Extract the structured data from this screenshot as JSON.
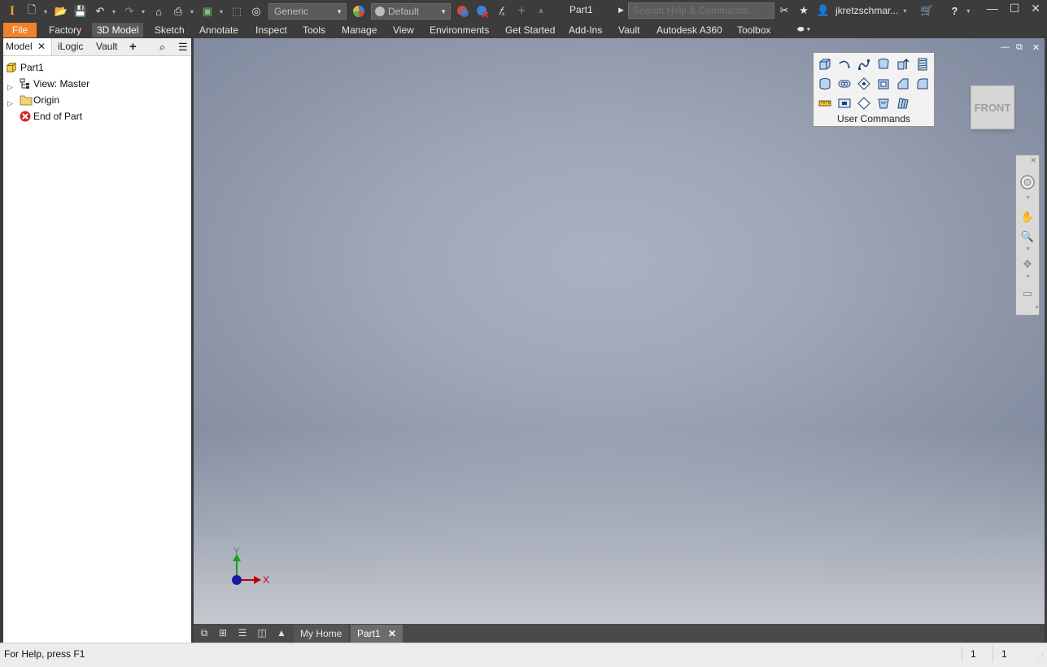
{
  "app": {
    "doc_title": "Part1"
  },
  "toolbar": {
    "material": "Generic",
    "appearance": "Default",
    "search_placeholder": "Search Help & Commands...",
    "user": "jkretzschmar..."
  },
  "ribbon": {
    "tabs": [
      "File",
      "Factory",
      "3D Model",
      "Sketch",
      "Annotate",
      "Inspect",
      "Tools",
      "Manage",
      "View",
      "Environments",
      "Get Started",
      "Add-Ins",
      "Vault",
      "Autodesk A360",
      "Toolbox"
    ],
    "active_tab": "3D Model"
  },
  "browser": {
    "tabs": [
      "Model",
      "iLogic",
      "Vault"
    ],
    "tree": [
      {
        "label": "Part1"
      },
      {
        "label": "View: Master"
      },
      {
        "label": "Origin"
      },
      {
        "label": "End of Part"
      }
    ]
  },
  "user_commands": {
    "label": "User Commands"
  },
  "viewcube": {
    "face": "FRONT"
  },
  "axes": {
    "x": "X",
    "y": "Y"
  },
  "doc_tabs": {
    "home": "My Home",
    "part": "Part1"
  },
  "status": {
    "help": "For Help, press F1",
    "count1": "1",
    "count2": "1"
  },
  "colors": {
    "file_tab": "#f0822b",
    "ui_dark": "#3c3c3c",
    "axis_x": "#c00000",
    "axis_y": "#1a9e1a"
  }
}
